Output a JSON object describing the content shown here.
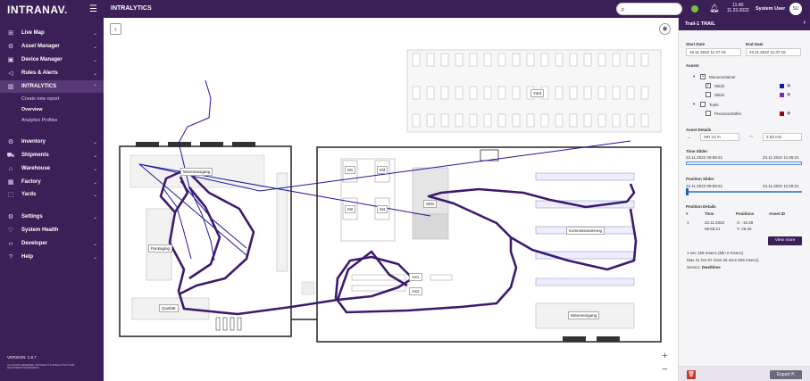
{
  "app": {
    "logo": "INTRANAV.",
    "page_title": "INTRALYTICS"
  },
  "sidebar": {
    "items": [
      {
        "label": "Live Map",
        "icon": "map-icon",
        "glyph": "⊞"
      },
      {
        "label": "Asset Manager",
        "icon": "asset-icon",
        "glyph": "⚙"
      },
      {
        "label": "Device Manager",
        "icon": "device-icon",
        "glyph": "▣"
      },
      {
        "label": "Rules & Alerts",
        "icon": "megaphone-icon",
        "glyph": "◁"
      },
      {
        "label": "INTRALYTICS",
        "icon": "chart-icon",
        "glyph": "▥"
      },
      {
        "label": "Inventory",
        "icon": "inventory-icon",
        "glyph": "⚙"
      },
      {
        "label": "Shipments",
        "icon": "truck-icon",
        "glyph": "⛟"
      },
      {
        "label": "Warehouse",
        "icon": "warehouse-icon",
        "glyph": "⌂"
      },
      {
        "label": "Factory",
        "icon": "factory-icon",
        "glyph": "▦"
      },
      {
        "label": "Yards",
        "icon": "yard-icon",
        "glyph": "⬚"
      },
      {
        "label": "Settings",
        "icon": "gear-icon",
        "glyph": "⚙"
      },
      {
        "label": "System Health",
        "icon": "heart-icon",
        "glyph": "♡"
      },
      {
        "label": "Developer",
        "icon": "code-icon",
        "glyph": "‹›"
      },
      {
        "label": "Help",
        "icon": "help-icon",
        "glyph": "?"
      }
    ],
    "sub_items": [
      "Create new report",
      "Overview",
      "Analytics Profiles"
    ],
    "version": "VERSION: 1.8.7",
    "legal": "ALL RIGHTS RESERVED. INTRANAV ® & INTRALYTICS ® ARE REGISTERED TRADEMARKS."
  },
  "header": {
    "time": "11:40",
    "date": "11.23.2022",
    "user": "System User",
    "initials": "SU"
  },
  "map": {
    "labels": {
      "yard": "Yard",
      "warenausgang": "Warenausgang",
      "packaging": "Packaging",
      "qualitaet": "Qualität",
      "m1": "M1",
      "m2": "M2",
      "m3": "M3",
      "m4": "M4",
      "sm1": "SM1",
      "as1": "AS1",
      "as2": "AS2",
      "kommissionierung": "Kommissionierung",
      "wareneingang": "Wareneingang"
    },
    "zoom_in": "+",
    "zoom_out": "−"
  },
  "panel": {
    "title": "Trail-1 TRAIL",
    "start_label": "Start Date",
    "start_value": "16.11.2022 11:37:16",
    "end_label": "End Date",
    "end_value": "23.11.2022 11:37:16",
    "assets_label": "Assets",
    "groups": [
      {
        "name": "Monocontainer",
        "assets": [
          {
            "name": "Skid2",
            "checked": true,
            "color": "#1a1aa8"
          },
          {
            "name": "Skid1",
            "checked": false,
            "color": "#7a2bb3"
          }
        ]
      },
      {
        "name": "Tools",
        "assets": [
          {
            "name": "PrecisionDriller",
            "checked": false,
            "color": "#8b0f1a"
          }
        ]
      }
    ],
    "details_label": "Asset Details",
    "distance": "297.14 m",
    "speed": "2.53 m/s",
    "time_slider_label": "Time Slider",
    "time_start": "22.11.2022 09:59:21",
    "time_end": "23.11.2022 11:09:21",
    "position_slider_label": "Position Slider",
    "pos_start": "22.11.2022 09:59:21",
    "pos_end": "23.11.2022 11:09:21",
    "pos_details_label": "Position Details",
    "table_headers": [
      "#",
      "Time",
      "Positions",
      "Asset ID"
    ],
    "row": {
      "num": "1",
      "time_a": "22.11.2022",
      "time_b": "09:59:21",
      "pos_x": "X: -10.49",
      "pos_y": "Y: 28.25"
    },
    "view_more": "View more",
    "dwell_line1": "1 sec 159 msecs (Min 0 msecs)",
    "dwell_line2": "Max 21 hrs 57 mins 26 secs 926 msecs)",
    "sensor_label": "Sensor:",
    "sensor_value": "Dwelltime",
    "export": "Export"
  }
}
